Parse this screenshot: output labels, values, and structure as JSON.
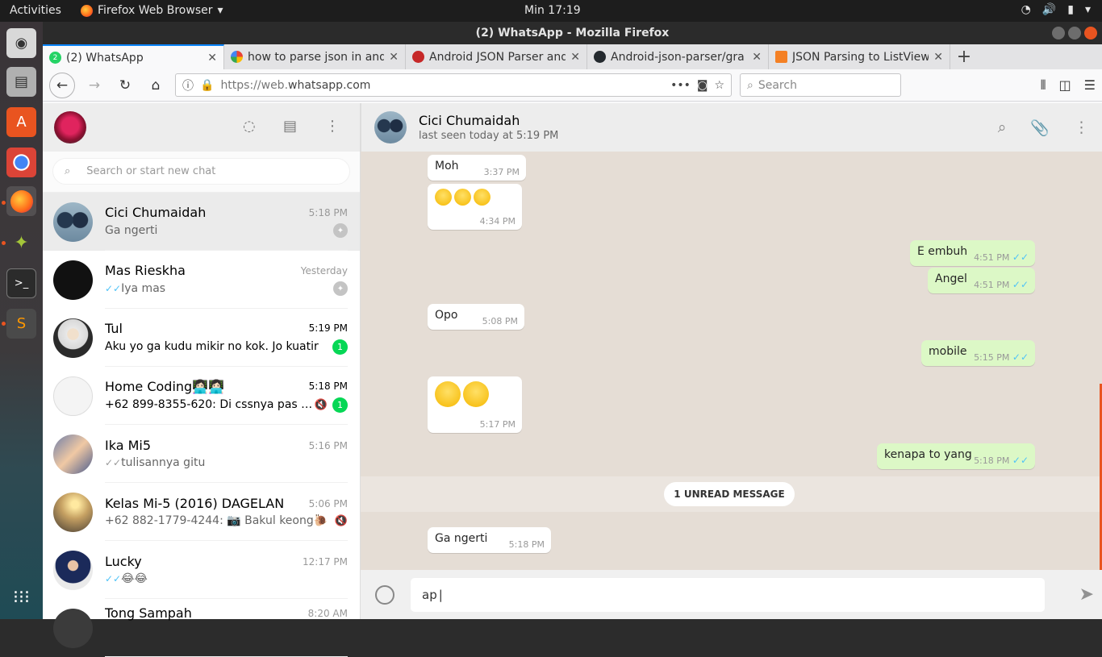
{
  "system": {
    "activities": "Activities",
    "app_name": "Firefox Web Browser",
    "clock": "Min 17:19"
  },
  "browser": {
    "window_title": "(2) WhatsApp - Mozilla Firefox",
    "tabs": [
      {
        "label": "(2) WhatsApp",
        "active": true
      },
      {
        "label": "how to parse json in and",
        "active": false
      },
      {
        "label": "Android JSON Parser and",
        "active": false
      },
      {
        "label": "Android-json-parser/gra",
        "active": false
      },
      {
        "label": "JSON Parsing to ListView",
        "active": false
      }
    ],
    "url_prefix": "https://web.",
    "url_domain": "whatsapp.com",
    "search_placeholder": "Search"
  },
  "sidebar": {
    "search_placeholder": "Search or start new chat",
    "chats": [
      {
        "name": "Cici Chumaidah",
        "time": "5:18 PM",
        "preview": "Ga ngerti",
        "pinned": true,
        "selected": true
      },
      {
        "name": "Mas Rieskha",
        "time": "Yesterday",
        "preview": "Iya mas",
        "pinned": true,
        "tick": "blue"
      },
      {
        "name": "Tul",
        "time": "5:19 PM",
        "preview": "Aku yo ga kudu mikir no kok. Jo kuatir",
        "unread": "1"
      },
      {
        "name": "Home Coding👩🏻‍💻👩🏻‍💻",
        "time": "5:18 PM",
        "preview": "+62 899-8355-620: Di cssnya pas add...",
        "muted": true,
        "unread": "1"
      },
      {
        "name": "Ika Mi5",
        "time": "5:16 PM",
        "preview": "tulisannya gitu",
        "tick": "grey"
      },
      {
        "name": "Kelas Mi-5 (2016) DAGELAN",
        "time": "5:06 PM",
        "preview": "+62 882-1779-4244: 📷 Bakul keong🐌",
        "muted": true
      },
      {
        "name": "Lucky",
        "time": "12:17 PM",
        "preview": "😂😂",
        "tick": "blue"
      },
      {
        "name": "Tong Sampah",
        "time": "8:20 AM",
        "preview": ""
      }
    ]
  },
  "conversation": {
    "contact_name": "Cici Chumaidah",
    "last_seen": "last seen today at 5:19 PM",
    "messages": [
      {
        "dir": "in",
        "text": "Moh",
        "time": "3:37 PM"
      },
      {
        "dir": "in",
        "text": "",
        "emoji": "😑😑😑",
        "time": "4:34 PM"
      },
      {
        "dir": "out",
        "text": "E embuh",
        "time": "4:51 PM"
      },
      {
        "dir": "out",
        "text": "Angel",
        "time": "4:51 PM"
      },
      {
        "dir": "in",
        "text": "Opo",
        "time": "5:08 PM"
      },
      {
        "dir": "out",
        "text": "mobile",
        "time": "5:15 PM"
      },
      {
        "dir": "in",
        "text": "",
        "emoji": "😩😩",
        "time": "5:17 PM"
      },
      {
        "dir": "out",
        "text": "kenapa to yang",
        "time": "5:18 PM"
      },
      {
        "dir": "in",
        "text": "Ga ngerti",
        "time": "5:18 PM"
      }
    ],
    "unread_banner": "1 UNREAD MESSAGE",
    "composer_text": "ap"
  },
  "colors": {
    "accent": "#06d755",
    "outgoing_bubble": "#dcf8c6",
    "chat_background": "#e5ddd5",
    "read_tick": "#4fc3f7"
  }
}
